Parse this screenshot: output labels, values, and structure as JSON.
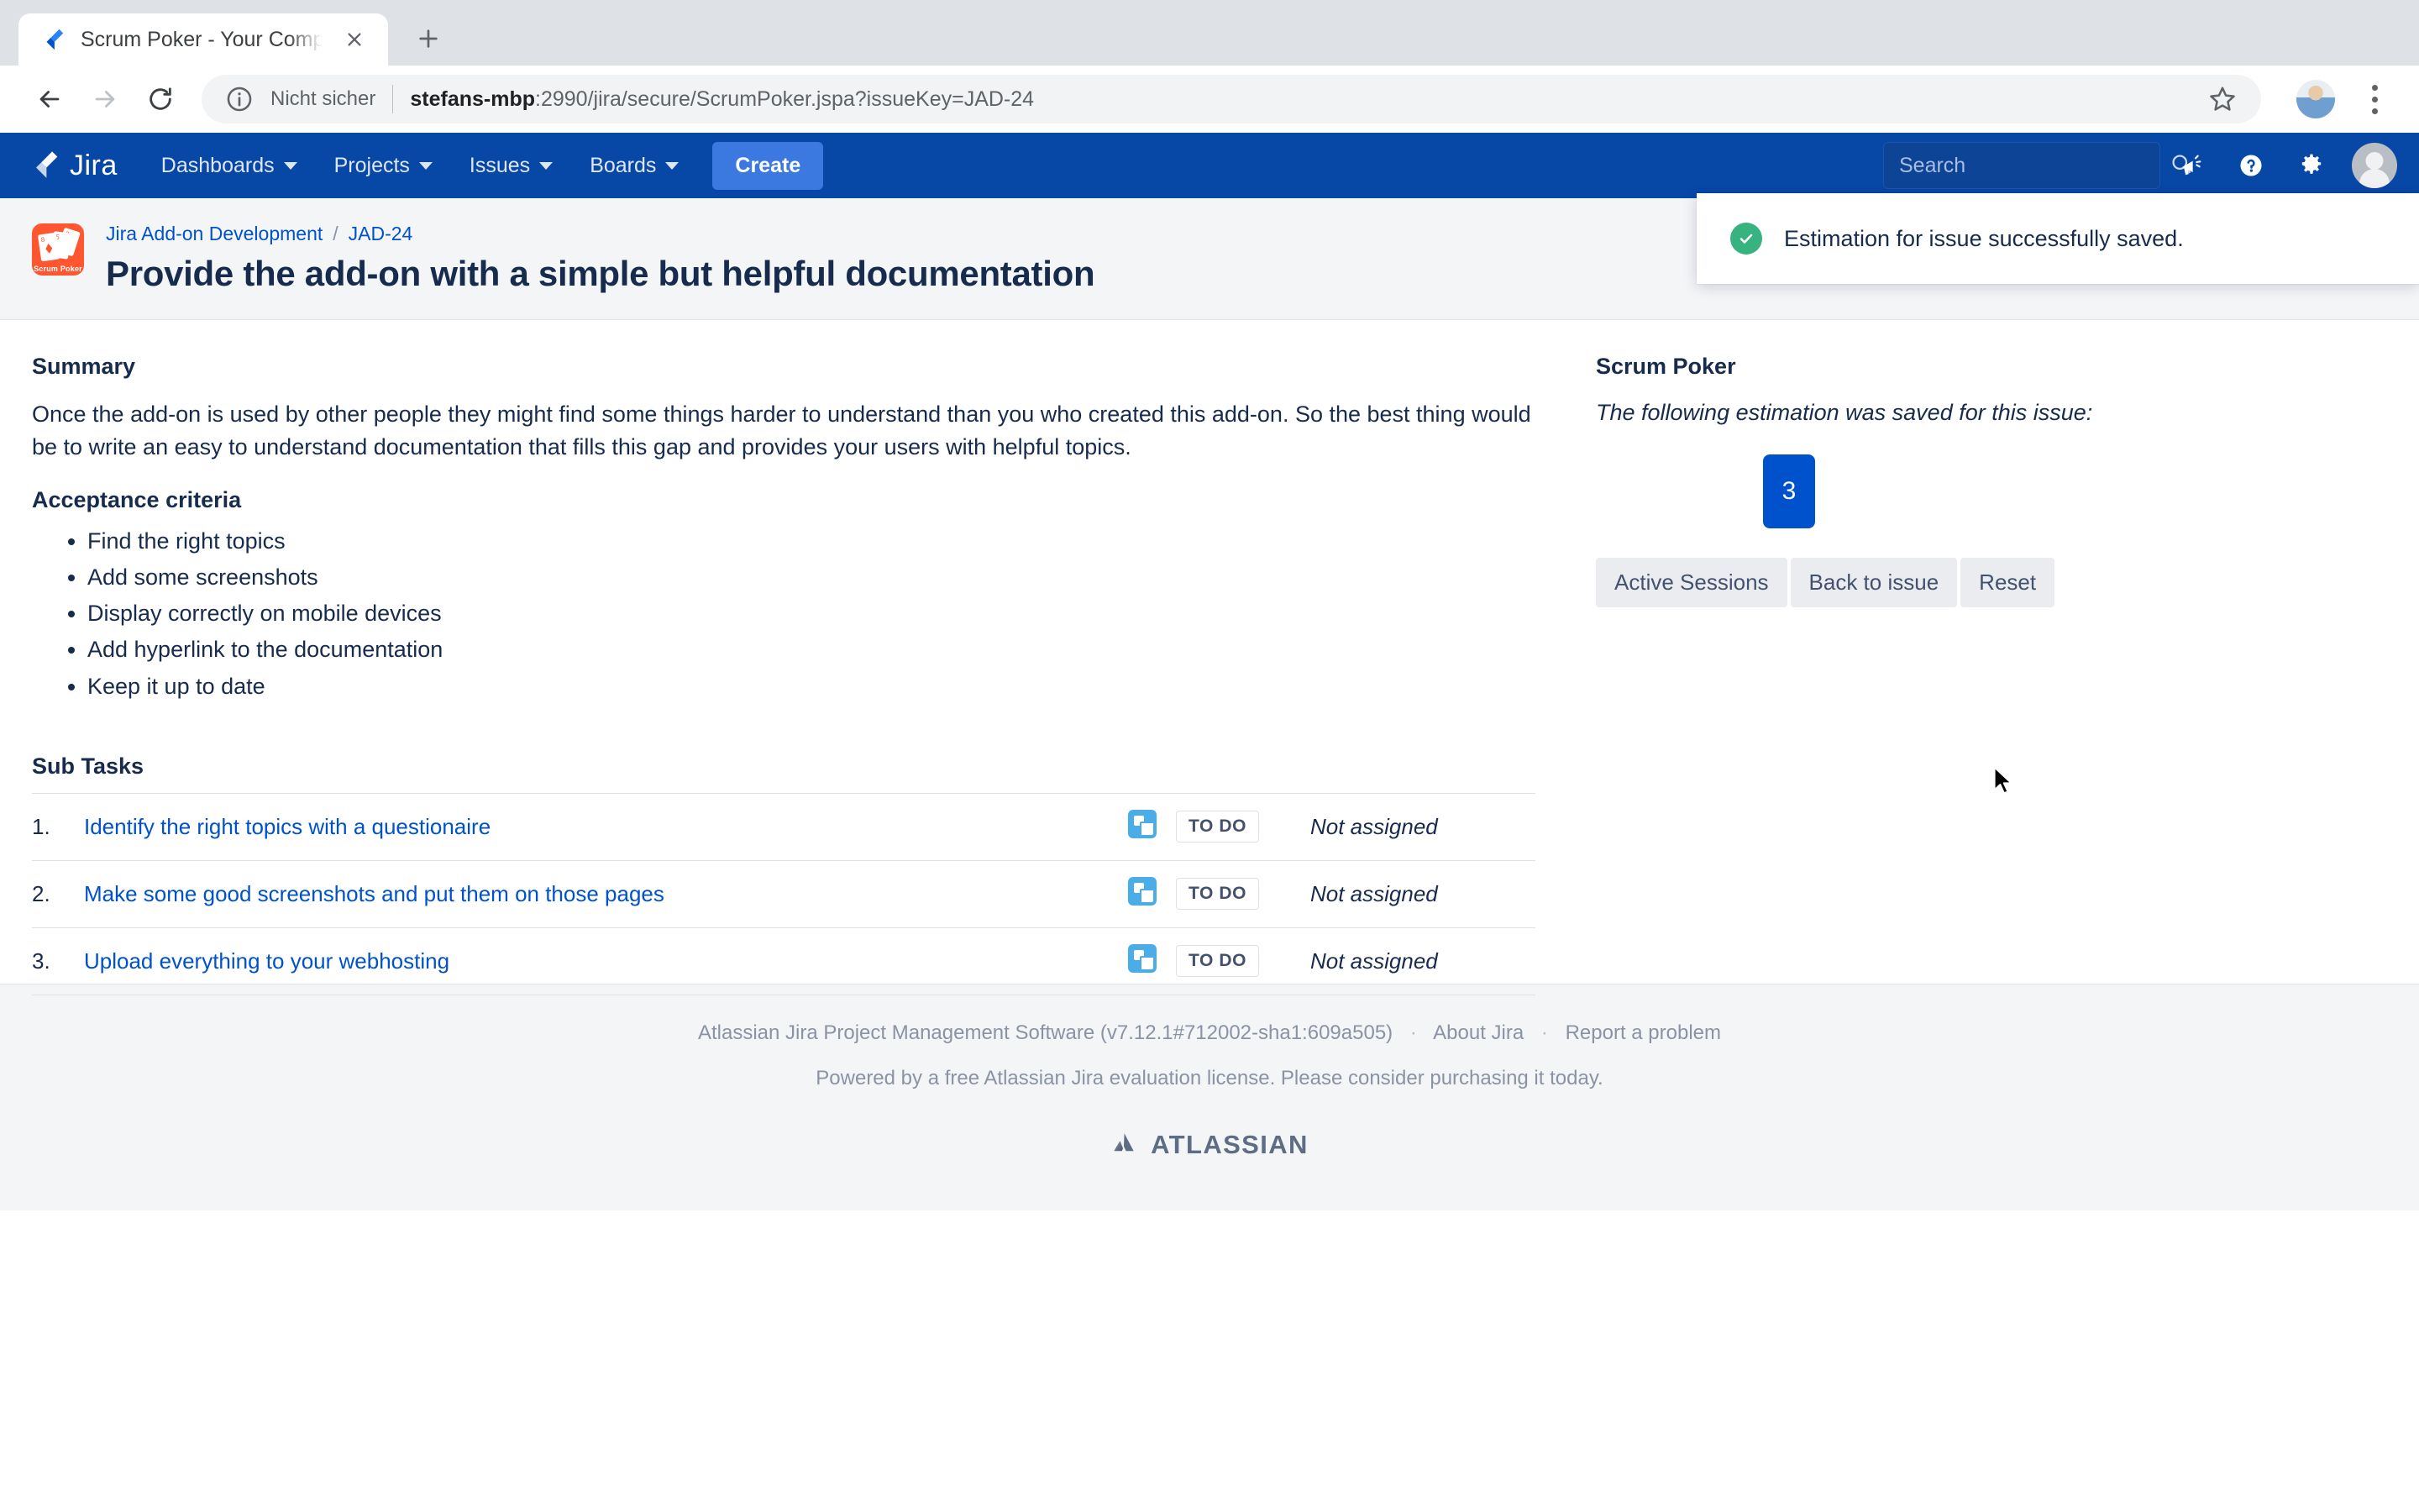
{
  "browser": {
    "tab": {
      "title": "Scrum Poker - Your Company J",
      "favicon_icon": "jira-favicon",
      "close_icon": "close-icon"
    },
    "new_tab_icon": "plus-icon",
    "back_icon": "back-arrow-icon",
    "forward_icon": "forward-arrow-icon",
    "reload_icon": "reload-icon",
    "omnibox": {
      "info_icon": "info-circle-icon",
      "security_label": "Nicht sicher",
      "url_host": "stefans-mbp",
      "url_rest": ":2990/jira/secure/ScrumPoker.jspa?issueKey=JAD-24",
      "star_icon": "bookmark-star-icon"
    },
    "profile_icon": "browser-profile-avatar",
    "menu_icon": "three-dot-menu-icon"
  },
  "jira_nav": {
    "logo_text": "Jira",
    "logo_icon": "jira-logo-icon",
    "items": [
      {
        "label": "Dashboards"
      },
      {
        "label": "Projects"
      },
      {
        "label": "Issues"
      },
      {
        "label": "Boards"
      }
    ],
    "create_label": "Create",
    "search_placeholder": "Search",
    "search_value": "",
    "search_icon": "search-icon",
    "announcement_icon": "megaphone-icon",
    "help_icon": "help-circle-icon",
    "settings_icon": "gear-icon",
    "avatar_icon": "user-avatar"
  },
  "issue": {
    "project_avatar_label": "Scrum Poker",
    "breadcrumb": {
      "project": "Jira Add-on Development",
      "separator": "/",
      "key": "JAD-24"
    },
    "title": "Provide the add-on with a simple but helpful documentation"
  },
  "toast": {
    "icon": "success-check-icon",
    "message": "Estimation for issue successfully saved."
  },
  "summary": {
    "heading": "Summary",
    "text": "Once the add-on is used by other people they might find some things harder to understand than you who created this add-on. So the best thing would be to write an easy to understand documentation that fills this gap and provides your users with helpful topics.",
    "criteria_heading": "Acceptance criteria",
    "criteria": [
      "Find the right topics",
      "Add some screenshots",
      "Display correctly on mobile devices",
      "Add hyperlink to the documentation",
      "Keep it up to date"
    ]
  },
  "subtasks": {
    "heading": "Sub Tasks",
    "rows": [
      {
        "num": "1.",
        "title": "Identify the right topics with a questionaire",
        "icon": "subtask-icon",
        "status": "TO DO",
        "assignee": "Not assigned"
      },
      {
        "num": "2.",
        "title": "Make some good screenshots and put them on those pages",
        "icon": "subtask-icon",
        "status": "TO DO",
        "assignee": "Not assigned"
      },
      {
        "num": "3.",
        "title": "Upload everything to your webhosting",
        "icon": "subtask-icon",
        "status": "TO DO",
        "assignee": "Not assigned"
      }
    ]
  },
  "scrum_poker": {
    "heading": "Scrum Poker",
    "note": "The following estimation was saved for this issue:",
    "estimation": "3",
    "buttons": [
      {
        "label": "Active Sessions"
      },
      {
        "label": "Back to issue"
      },
      {
        "label": "Reset"
      }
    ]
  },
  "footer": {
    "product": "Atlassian Jira Project Management Software (v7.12.1#712002-sha1:609a505)",
    "about": "About Jira",
    "report": "Report a problem",
    "dot": "·",
    "license": "Powered by a free Atlassian Jira evaluation license. Please consider purchasing it today.",
    "logo_text": "ATLASSIAN",
    "logo_icon": "atlassian-logo-icon"
  },
  "colors": {
    "jira_nav_blue": "#0747a6",
    "create_blue": "#3b79e0",
    "link_blue": "#0052cc",
    "text_dark": "#172b4d",
    "success_green": "#36b37e",
    "project_orange": "#ff5630",
    "subtask_blue": "#4bade8"
  }
}
